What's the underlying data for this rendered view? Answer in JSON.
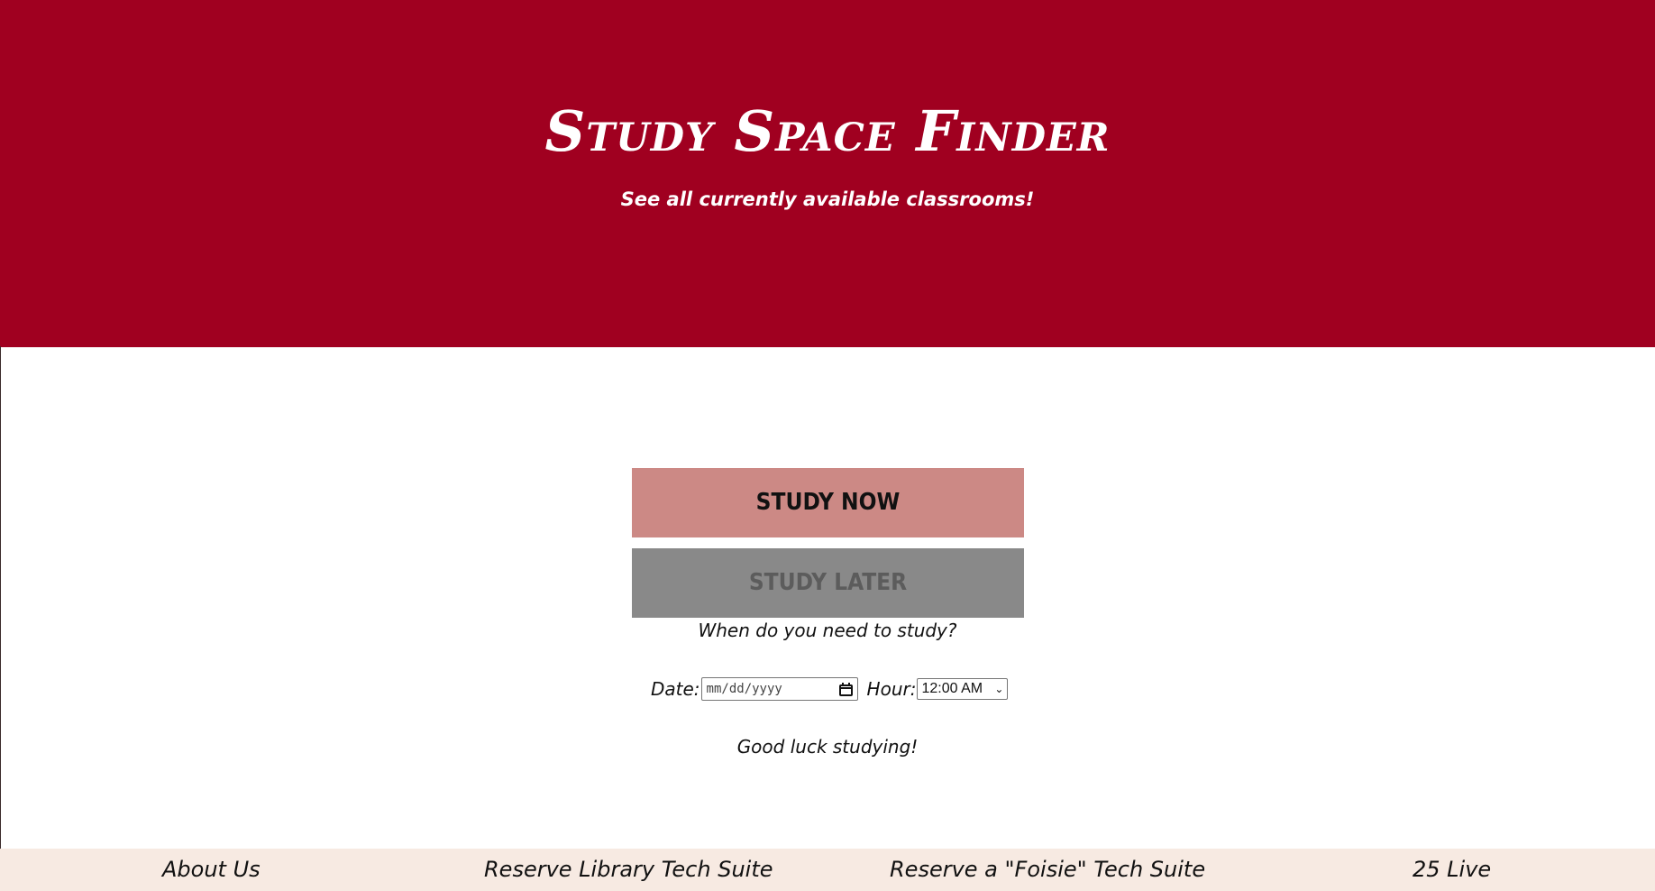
{
  "hero": {
    "title": "Study Space Finder",
    "subtitle": "See all currently available classrooms!",
    "background_color": "#a00020"
  },
  "actions": {
    "study_now_label": "STUDY NOW",
    "study_now_color": "#cc8985",
    "study_later_label": "STUDY LATER",
    "study_later_color": "#898989"
  },
  "form": {
    "question": "When do you need to study?",
    "date_label": "Date:",
    "date_placeholder": "mm/dd/yyyy",
    "hour_label": "Hour:",
    "hour_selected": "12:00 AM"
  },
  "message": "Good luck studying!",
  "footer": {
    "background_color": "#f7eae2",
    "links": [
      "About Us",
      "Reserve Library Tech Suite",
      "Reserve a \"Foisie\" Tech Suite",
      "25 Live"
    ]
  }
}
